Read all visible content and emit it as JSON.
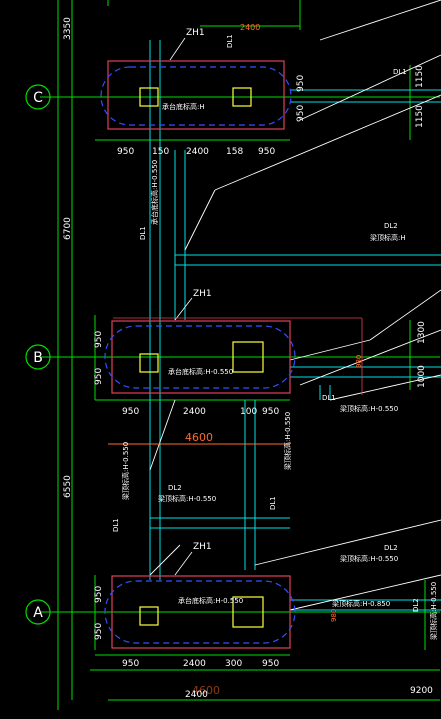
{
  "colors": {
    "background": "#000000",
    "grid": "#00dd00",
    "beam": "#00e0e0",
    "footing": "#e0405a",
    "pile": "#ffff40",
    "dashed_outline": "#3050ff",
    "dim_text": "#ffffff",
    "total_dim": "#ff6a2a",
    "wall": "#ffffff"
  },
  "axes": {
    "c": "C",
    "b": "B",
    "a": "A"
  },
  "left_dims": {
    "top": "3350",
    "c_to_b": "6700",
    "b_to_a": "6550"
  },
  "footing_c": {
    "tag": "ZH1",
    "elev": "承台底标高:H",
    "dims": [
      "950",
      "150",
      "2400",
      "158",
      "950"
    ],
    "side_top": "950",
    "side_bottom": "950",
    "vert_label": "承台底标高:H-0.550",
    "dl_label": "DL1"
  },
  "footing_b": {
    "tag": "ZH1",
    "elev": "承台底标高:H-0.550",
    "dims": [
      "950",
      "2400",
      "100",
      "950"
    ],
    "side_top": "950",
    "side_bottom": "950",
    "total": "4600",
    "dl_label": "DL1"
  },
  "footing_a": {
    "tag": "ZH1",
    "elev": "承台底标高:H-0.550",
    "dims": [
      "950",
      "2400",
      "300",
      "950"
    ],
    "side_top": "950",
    "side_bottom": "950",
    "total": "2400",
    "total_overlay": "4600",
    "dl_label": "DL1"
  },
  "annotations": {
    "top_red": "2400",
    "dl1_top": "DL1",
    "dl1_right_top": "DL1",
    "right_1150": "1150",
    "right_1150b": "1150",
    "dl2_right": "DL2",
    "dl2_right_elev": "梁顶标高:H",
    "right_1300": "1300",
    "right_1000": "1000",
    "dl1_mid": "DL1",
    "dl1_mid_elev": "梁顶标高:H-0.550",
    "left_vert_1": "梁顶标高:H-0.550",
    "dl1_left": "DL1",
    "dl2_mid": "DL2",
    "dl2_mid_elev": "梁顶标高:H-0.550",
    "dl1_vert2": "DL1",
    "vert_elev2": "梁顶标高:H-0.550",
    "dl2_lower": "DL2",
    "dl2_lower_elev": "梁顶标高:H-0.550",
    "elev_0850": "梁顶标高:H-0.850",
    "dl2_far": "DL2",
    "elev_far": "梁顶标高:H-0.550",
    "bottom_right": "9200",
    "dim_980a": "980",
    "dim_980b": "980"
  }
}
